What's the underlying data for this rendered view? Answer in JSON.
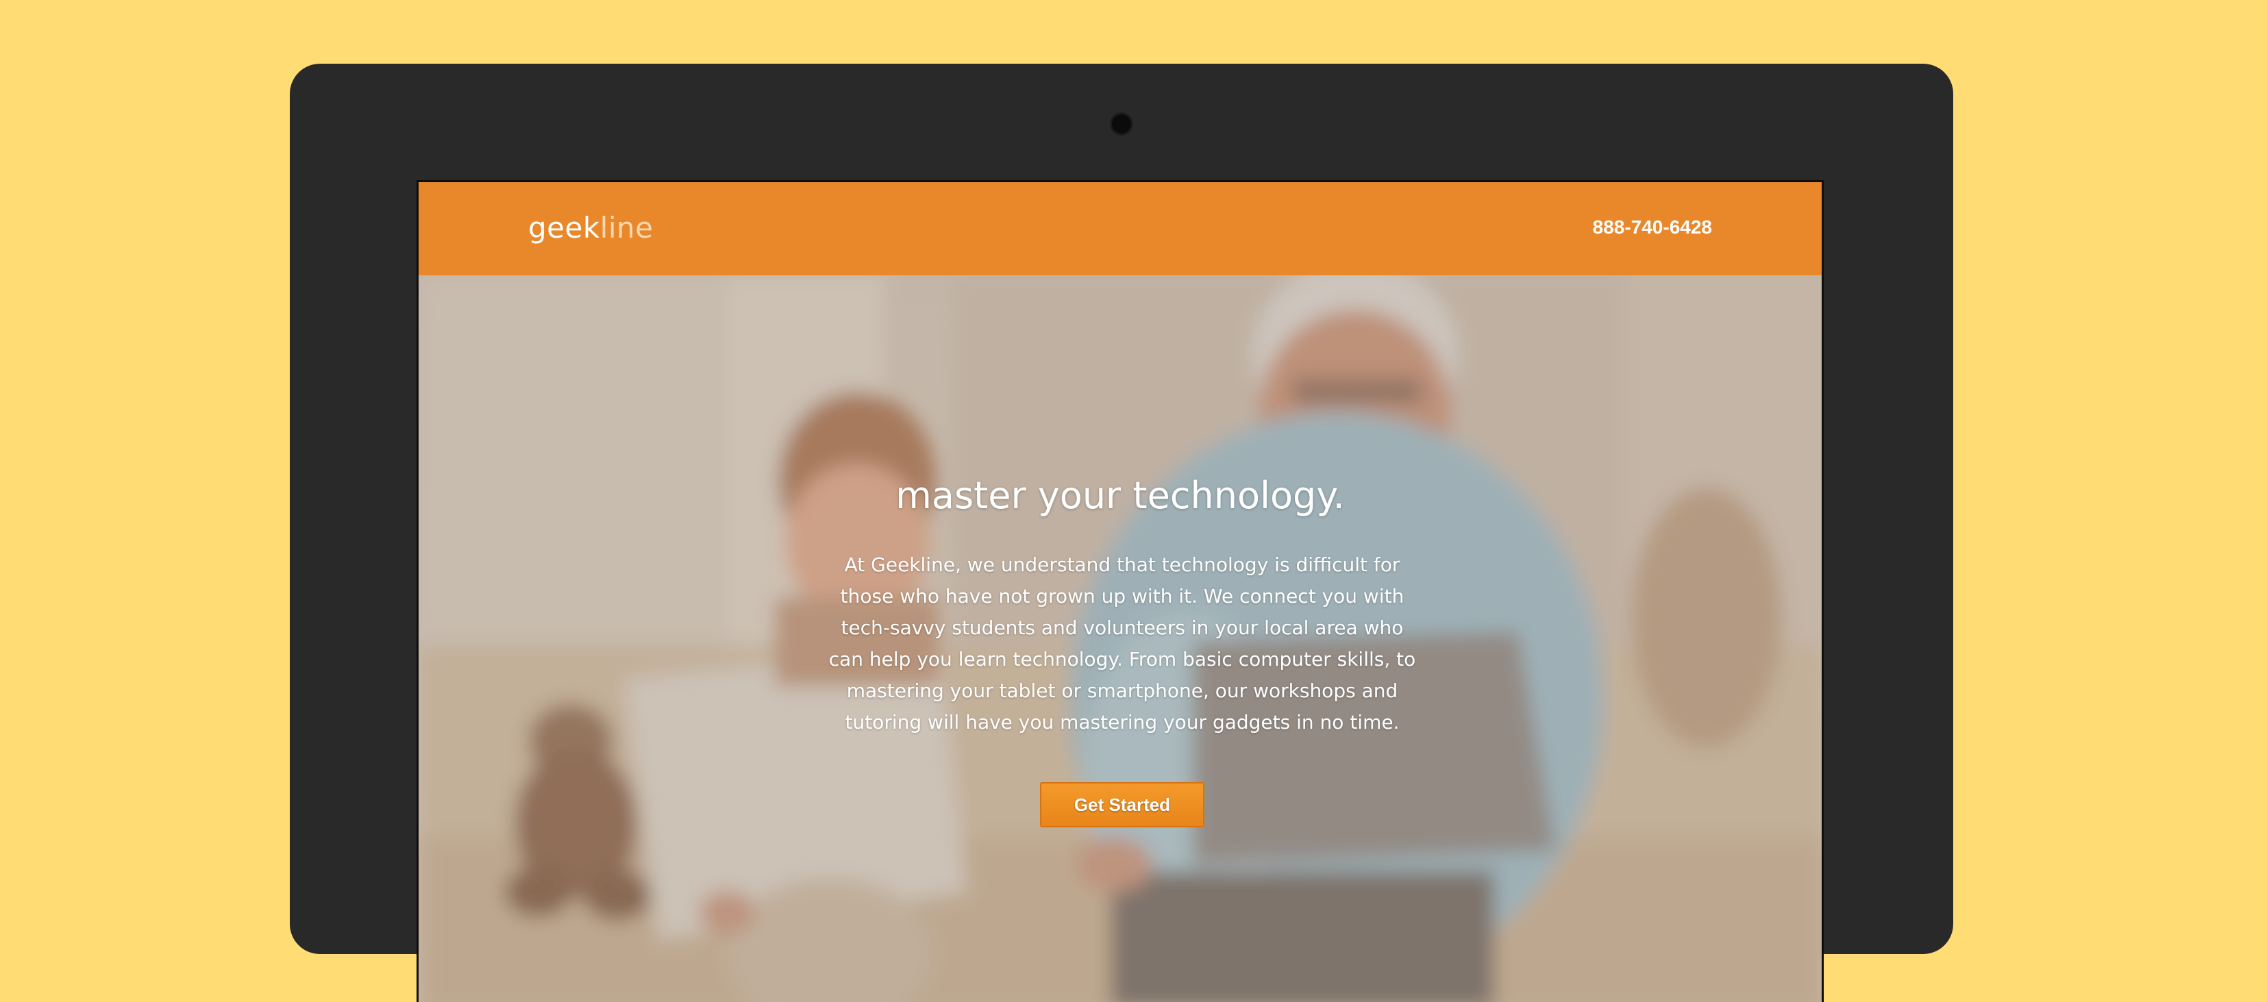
{
  "header": {
    "logo_primary": "geek",
    "logo_secondary": "line",
    "phone": "888-740-6428"
  },
  "hero": {
    "headline": "master your technology.",
    "body": "At Geekline, we understand that technology is difficult for those who have not grown up with it. We connect you with tech-savvy students and volunteers in your local area who can help you learn technology. From basic computer skills, to mastering your tablet or smartphone, our workshops and tutoring will have you mastering your gadgets in no time.",
    "cta_label": "Get Started"
  },
  "colors": {
    "backdrop": "#ffdc74",
    "device_frame": "#282928",
    "header_bg": "#e8882b",
    "cta_bg": "#f2921f"
  },
  "icons": {
    "camera": "camera-dot-icon"
  }
}
